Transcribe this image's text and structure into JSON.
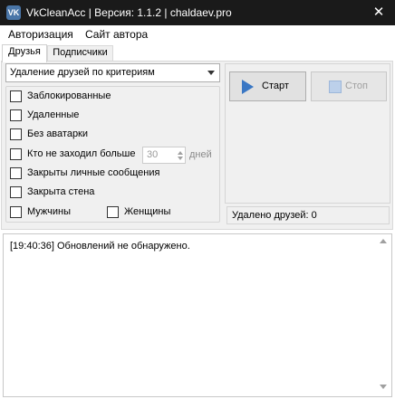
{
  "window": {
    "title": "VkCleanAcc | Версия: 1.1.2 | chaldaev.pro",
    "app_icon_text": "VK",
    "close_glyph": "✕"
  },
  "menu": {
    "items": [
      {
        "label": "Авторизация"
      },
      {
        "label": "Сайт автора"
      }
    ]
  },
  "tabs": [
    {
      "label": "Друзья",
      "active": true
    },
    {
      "label": "Подписчики",
      "active": false
    }
  ],
  "mode_select": {
    "value": "Удаление друзей по критериям"
  },
  "criteria": {
    "blocked": "Заблокированные",
    "deleted": "Удаленные",
    "no_avatar": "Без аватарки",
    "inactive": "Кто не заходил больше",
    "inactive_days_value": "30",
    "inactive_days_unit": "дней",
    "closed_messages": "Закрыты личные сообщения",
    "closed_wall": "Закрыта стена",
    "men": "Мужчины",
    "women": "Женщины"
  },
  "actions": {
    "start_label": "Старт",
    "stop_label": "Стоп"
  },
  "status": {
    "deleted_count_text": "Удалено друзей: 0"
  },
  "log": {
    "lines": [
      "[19:40:36] Обновлений не обнаружено."
    ]
  },
  "colors": {
    "titlebar": "#1a1a1a",
    "accent": "#3a77c4",
    "panel_bg": "#f0f0f0"
  }
}
